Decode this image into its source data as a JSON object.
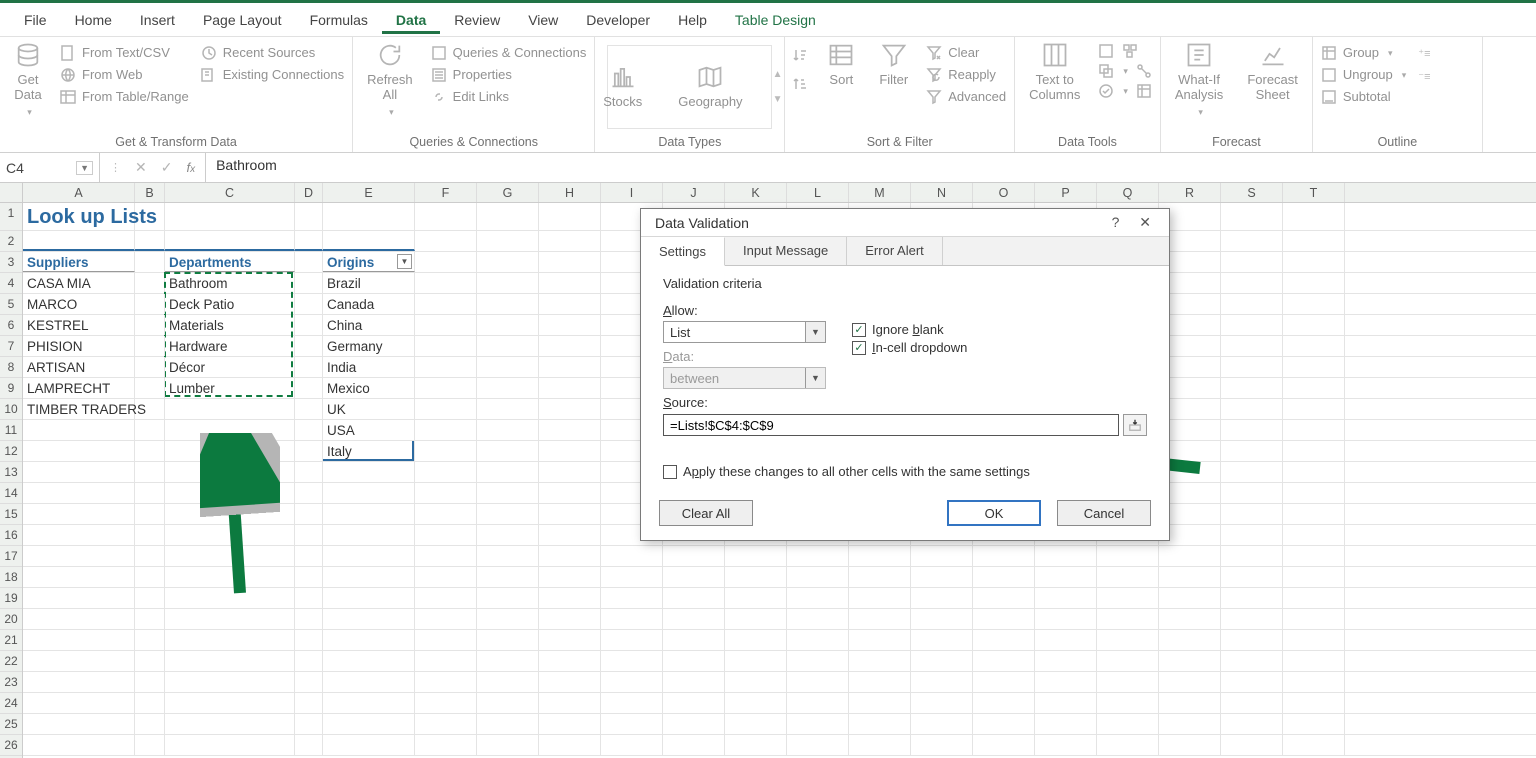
{
  "menu": {
    "tabs": [
      "File",
      "Home",
      "Insert",
      "Page Layout",
      "Formulas",
      "Data",
      "Review",
      "View",
      "Developer",
      "Help",
      "Table Design"
    ],
    "active": "Data",
    "context_tab": "Table Design"
  },
  "ribbon": {
    "groups": {
      "get_transform": {
        "label": "Get & Transform Data",
        "get_data": "Get\nData",
        "items": [
          "From Text/CSV",
          "From Web",
          "From Table/Range",
          "Recent Sources",
          "Existing Connections"
        ]
      },
      "queries": {
        "label": "Queries & Connections",
        "refresh": "Refresh\nAll",
        "items": [
          "Queries & Connections",
          "Properties",
          "Edit Links"
        ]
      },
      "data_types": {
        "label": "Data Types",
        "stocks": "Stocks",
        "geography": "Geography"
      },
      "sort_filter": {
        "label": "Sort & Filter",
        "sort": "Sort",
        "filter": "Filter",
        "clear": "Clear",
        "reapply": "Reapply",
        "advanced": "Advanced"
      },
      "data_tools": {
        "label": "Data Tools",
        "text_to_columns": "Text to\nColumns"
      },
      "forecast": {
        "label": "Forecast",
        "whatif": "What-If\nAnalysis",
        "fsheet": "Forecast\nSheet"
      },
      "outline": {
        "label": "Outline",
        "group": "Group",
        "ungroup": "Ungroup",
        "subtotal": "Subtotal"
      }
    }
  },
  "formula_bar": {
    "name_box": "C4",
    "value": "Bathroom"
  },
  "grid": {
    "columns": [
      "A",
      "B",
      "C",
      "D",
      "E",
      "F",
      "G",
      "H",
      "I",
      "J",
      "K",
      "L",
      "M",
      "N",
      "O",
      "P",
      "Q",
      "R",
      "S",
      "T"
    ],
    "title": "Look up Lists",
    "headers": {
      "A": "Suppliers",
      "C": "Departments",
      "E": "Origins"
    },
    "data": {
      "suppliers": [
        "CASA MIA",
        "MARCO",
        "KESTREL",
        "PHISION",
        "ARTISAN",
        "LAMPRECHT",
        "TIMBER TRADERS"
      ],
      "departments": [
        "Bathroom",
        "Deck Patio",
        "Materials",
        "Hardware",
        "Décor",
        "Lumber"
      ],
      "origins": [
        "Brazil",
        "Canada",
        "China",
        "Germany",
        "India",
        "Mexico",
        "UK",
        "USA",
        "Italy"
      ]
    }
  },
  "dialog": {
    "title": "Data Validation",
    "tabs": [
      "Settings",
      "Input Message",
      "Error Alert"
    ],
    "criteria_label": "Validation criteria",
    "allow_lbl": "Allow:",
    "allow_val": "List",
    "ignore_blank": "Ignore blank",
    "incell": "In-cell dropdown",
    "data_lbl": "Data:",
    "data_val": "between",
    "source_lbl": "Source:",
    "source_val": "=Lists!$C$4:$C$9",
    "apply_all": "Apply these changes to all other cells with the same settings",
    "buttons": {
      "clear": "Clear All",
      "ok": "OK",
      "cancel": "Cancel"
    }
  }
}
